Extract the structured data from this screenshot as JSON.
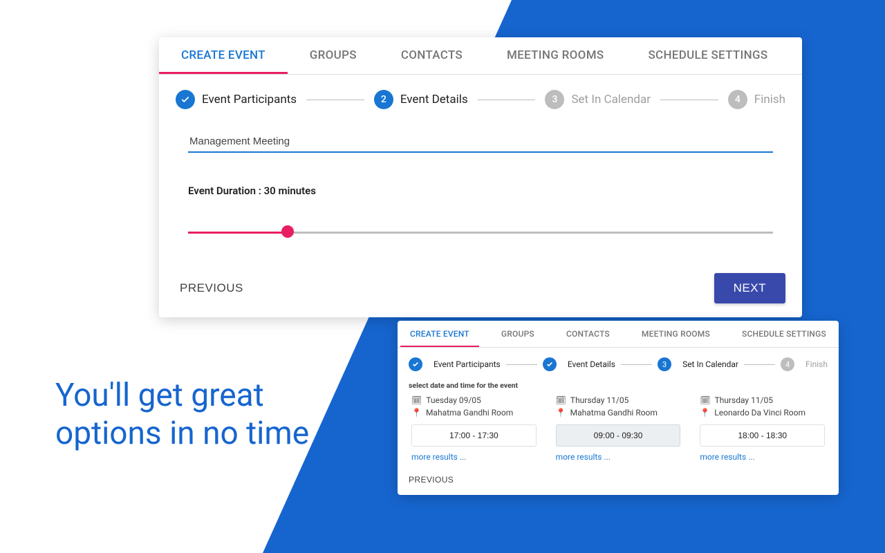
{
  "headline_line1": "You'll get great",
  "headline_line2": "options in no time",
  "tabs": [
    "CREATE EVENT",
    "GROUPS",
    "CONTACTS",
    "MEETING ROOMS",
    "SCHEDULE SETTINGS"
  ],
  "card1": {
    "steps": [
      {
        "label": "Event Participants"
      },
      {
        "num": "2",
        "label": "Event Details"
      },
      {
        "num": "3",
        "label": "Set In Calendar"
      },
      {
        "num": "4",
        "label": "Finish"
      }
    ],
    "event_name": "Management Meeting",
    "duration_label": "Event Duration : 30 minutes",
    "prev": "PREVIOUS",
    "next": "NEXT"
  },
  "card2": {
    "steps": [
      {
        "label": "Event Participants"
      },
      {
        "label": "Event Details"
      },
      {
        "num": "3",
        "label": "Set In Calendar"
      },
      {
        "num": "4",
        "label": "Finish"
      }
    ],
    "instruction": "select date and time for the event",
    "slots": [
      {
        "date": "Tuesday 09/05",
        "room": "Mahatma Gandhi Room",
        "time": "17:00 - 17:30",
        "more": "more results ..."
      },
      {
        "date": "Thursday 11/05",
        "room": "Mahatma Gandhi Room",
        "time": "09:00 - 09:30",
        "more": "more results ..."
      },
      {
        "date": "Thursday 11/05",
        "room": "Leonardo Da Vinci Room",
        "time": "18:00 - 18:30",
        "more": "more results ..."
      }
    ],
    "prev": "PREVIOUS"
  }
}
